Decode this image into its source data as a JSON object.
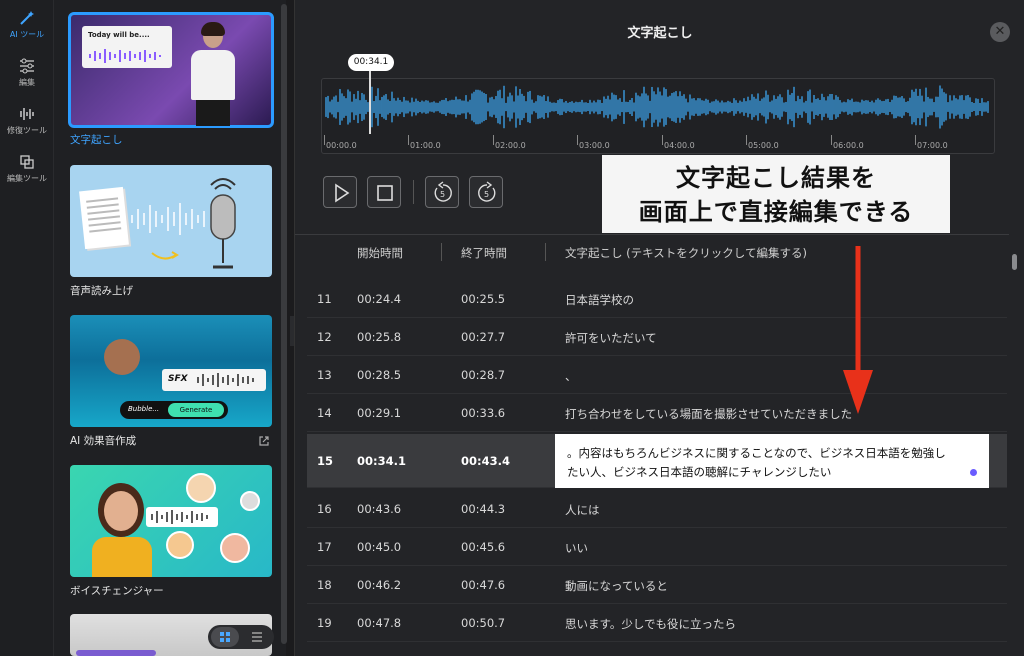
{
  "rail": {
    "items": [
      {
        "label": "AI ツール",
        "icon": "magic-wand-icon",
        "active": true
      },
      {
        "label": "編集",
        "icon": "sliders-icon",
        "active": false
      },
      {
        "label": "修復ツール",
        "icon": "waveform-repair-icon",
        "active": false
      },
      {
        "label": "編集ツール",
        "icon": "crop-icon",
        "active": false
      }
    ]
  },
  "tools": [
    {
      "label": "文字起こし",
      "thumb_text": "Today will be....",
      "active": true
    },
    {
      "label": "音声読み上げ"
    },
    {
      "label": "AI 効果音作成",
      "thumb_sfx": "SFX",
      "thumb_input": "Bubble...",
      "thumb_button": "Generate"
    },
    {
      "label": "ボイスチェンジャー"
    }
  ],
  "panel": {
    "title": "文字起こし",
    "playhead": "00:34.1",
    "ticks": [
      "00:00.0",
      "01:00.0",
      "02:00.0",
      "03:00.0",
      "04:00.0",
      "05:00.0",
      "06:00.0",
      "07:00.0"
    ]
  },
  "callout": {
    "line1": "文字起こし結果を",
    "line2": "画面上で直接編集できる"
  },
  "table": {
    "headers": {
      "start": "開始時間",
      "end": "終了時間",
      "text": "文字起こし (テキストをクリックして編集する)"
    },
    "rows": [
      {
        "n": "11",
        "start": "00:24.4",
        "end": "00:25.5",
        "text": "日本語学校の"
      },
      {
        "n": "12",
        "start": "00:25.8",
        "end": "00:27.7",
        "text": "許可をいただいて"
      },
      {
        "n": "13",
        "start": "00:28.5",
        "end": "00:28.7",
        "text": "、"
      },
      {
        "n": "14",
        "start": "00:29.1",
        "end": "00:33.6",
        "text": "打ち合わせをしている場面を撮影させていただきました"
      },
      {
        "n": "15",
        "start": "00:34.1",
        "end": "00:43.4",
        "text_line1": "。内容はもちろんビジネスに関することなので、ビジネス日本語を勉強し",
        "text_line2": "たい人、ビジネス日本語の聴解にチャレンジしたい"
      },
      {
        "n": "16",
        "start": "00:43.6",
        "end": "00:44.3",
        "text": "人には"
      },
      {
        "n": "17",
        "start": "00:45.0",
        "end": "00:45.6",
        "text": "いい"
      },
      {
        "n": "18",
        "start": "00:46.2",
        "end": "00:47.6",
        "text": "動画になっていると"
      },
      {
        "n": "19",
        "start": "00:47.8",
        "end": "00:50.7",
        "text": "思います。少しでも役に立ったら"
      }
    ]
  },
  "colors": {
    "accent": "#2b9bff",
    "wave": "#3fb0ff",
    "arrow": "#e8311a"
  }
}
